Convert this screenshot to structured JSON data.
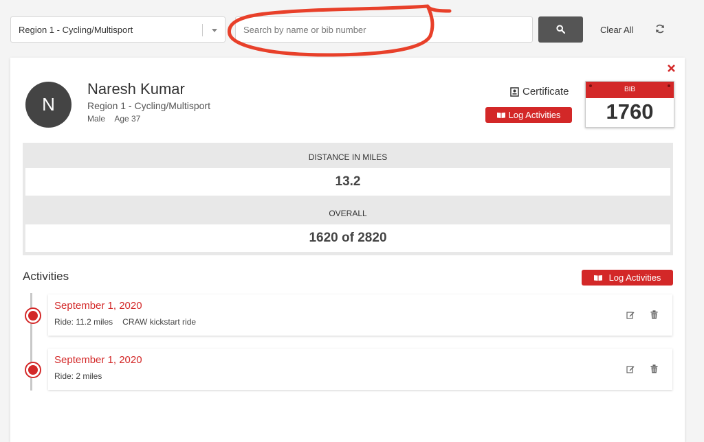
{
  "search": {
    "region_value": "Region 1 - Cycling/Multisport",
    "placeholder": "Search by name or bib number",
    "clear_all_label": "Clear All"
  },
  "participant": {
    "avatar_initial": "N",
    "name": "Naresh Kumar",
    "region": "Region 1 - Cycling/Multisport",
    "gender": "Male",
    "age": "Age 37",
    "certificate_label": "Certificate",
    "log_activities_label": "Log Activities",
    "bib_label": "BIB",
    "bib_number": "1760"
  },
  "stats": {
    "distance_label": "DISTANCE IN MILES",
    "distance_value": "13.2",
    "overall_label": "OVERALL",
    "overall_value": "1620 of 2820"
  },
  "activities": {
    "title": "Activities",
    "log_activities_label": "Log Activities",
    "items": [
      {
        "date": "September 1, 2020",
        "detail": "Ride: 11.2 miles",
        "note": "CRAW kickstart ride"
      },
      {
        "date": "September 1, 2020",
        "detail": "Ride: 2 miles",
        "note": ""
      }
    ]
  },
  "colors": {
    "accent": "#d32828",
    "search_button": "#555555",
    "annotation": "#e8402a"
  },
  "icons": [
    "chevron-down-icon",
    "search-icon",
    "refresh-icon",
    "close-icon",
    "certificate-icon",
    "book-icon",
    "edit-icon",
    "trash-icon"
  ]
}
